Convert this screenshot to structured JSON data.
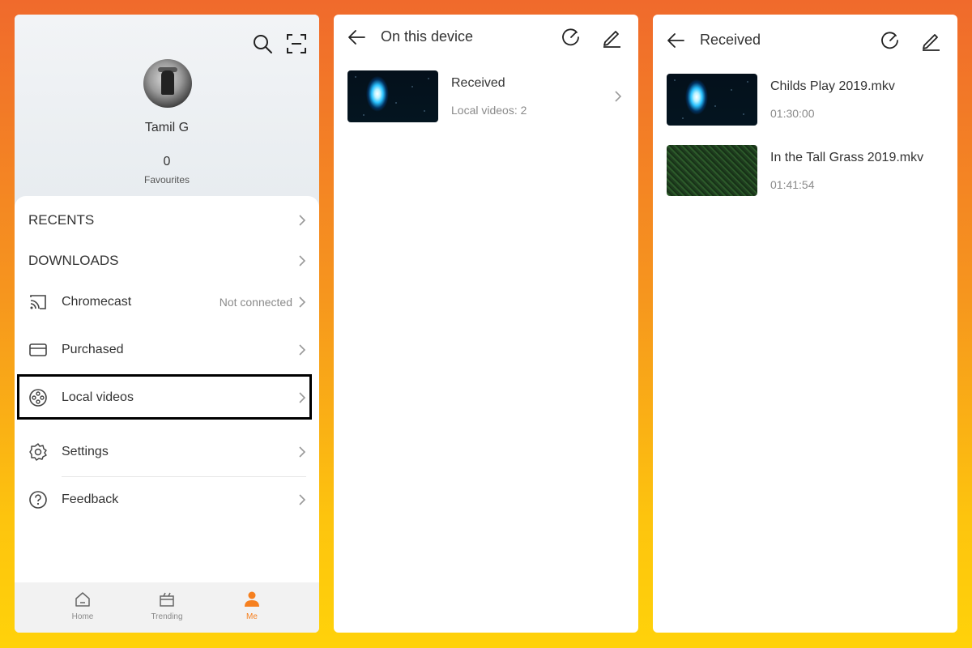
{
  "panel1": {
    "profile": {
      "name": "Tamil G",
      "favourites_count": "0",
      "favourites_label": "Favourites"
    },
    "top_icons": [
      "search-icon",
      "scan-icon"
    ],
    "menu": {
      "recents": "RECENTS",
      "downloads": "DOWNLOADS",
      "chromecast": "Chromecast",
      "chromecast_status": "Not connected",
      "purchased": "Purchased",
      "local_videos": "Local videos",
      "settings": "Settings",
      "feedback": "Feedback"
    },
    "bottom_nav": {
      "home": "Home",
      "trending": "Trending",
      "me": "Me",
      "active": "Me"
    }
  },
  "panel2": {
    "title": "On this device",
    "folder": {
      "name": "Received",
      "count": "Local videos: 2"
    }
  },
  "panel3": {
    "title": "Received",
    "videos": [
      {
        "title": "Childs Play 2019.mkv",
        "duration": "01:30:00"
      },
      {
        "title": "In the Tall Grass 2019.mkv",
        "duration": "01:41:54"
      }
    ]
  },
  "colors": {
    "accent": "#f6801f",
    "background_top": "#f06a2c",
    "background_bottom": "#ffd20a",
    "highlight_border": "#000000"
  }
}
